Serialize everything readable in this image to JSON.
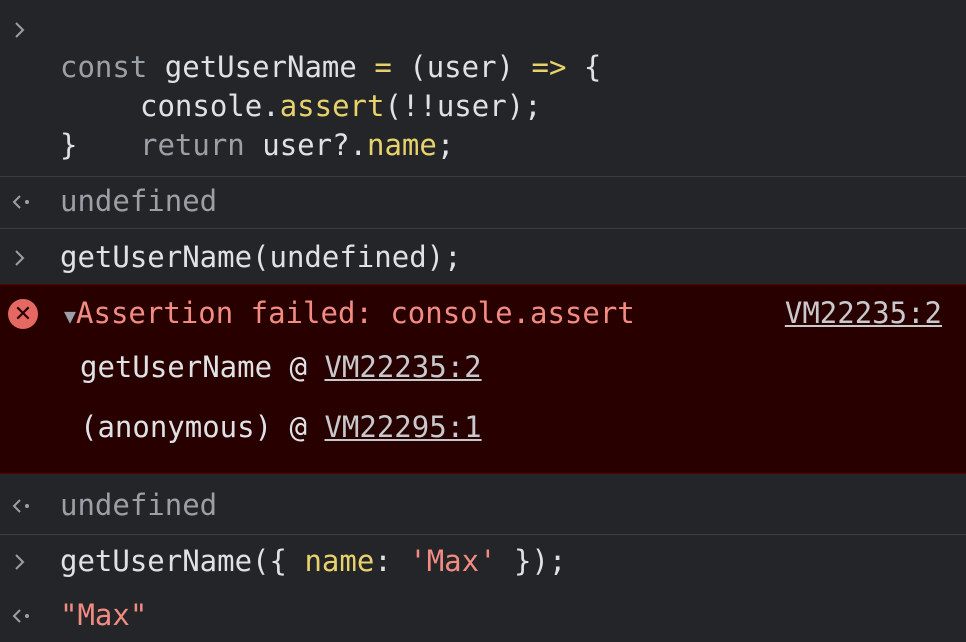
{
  "code_block": {
    "line1": {
      "kw": "const",
      "name": "getUserName",
      "eq": "=",
      "params": "(user)",
      "arrow": "=>",
      "brace": "{"
    },
    "line2": {
      "obj": "console.",
      "method": "assert",
      "args": "(!!user);"
    },
    "line3": {
      "kw": "return",
      "expr": "user?.",
      "prop": "name",
      "end": ";"
    },
    "line4": "}"
  },
  "result1": "undefined",
  "call1": "getUserName(undefined);",
  "error": {
    "message": "Assertion failed: console.assert",
    "location": "VM22235:2",
    "stack": [
      {
        "fn": "getUserName",
        "at": "@",
        "loc": "VM22235:2"
      },
      {
        "fn": "(anonymous)",
        "at": "@",
        "loc": "VM22295:1"
      }
    ]
  },
  "result2": "undefined",
  "call2": {
    "fn": "getUserName({",
    "key": "name",
    "colon": ":",
    "val": "'Max'",
    "end": "});"
  },
  "result3": "\"Max\"",
  "colors": {
    "background": "#242528",
    "error_bg": "#290000",
    "error_text": "#f28b82",
    "keyword": "#e8d26c"
  }
}
